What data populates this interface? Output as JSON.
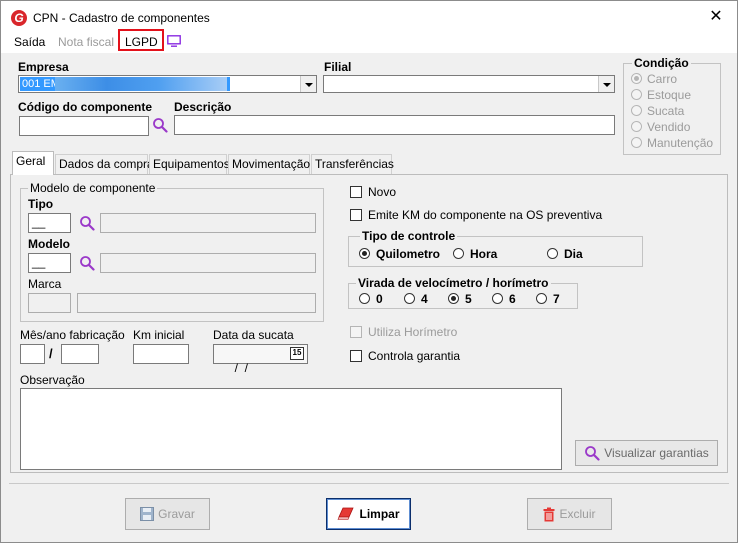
{
  "window": {
    "title": "CPN - Cadastro de componentes"
  },
  "menu": {
    "exit": "Saída",
    "invoice": "Nota fiscal",
    "lgpd": "LGPD"
  },
  "fields": {
    "company_label": "Empresa",
    "company_value": "001 EM",
    "branch_label": "Filial",
    "component_code_label": "Código do componente",
    "description_label": "Descrição"
  },
  "condition": {
    "title": "Condição",
    "options": [
      "Carro",
      "Estoque",
      "Sucata",
      "Vendido",
      "Manutenção"
    ],
    "selected": "Carro"
  },
  "tabs": [
    "Geral",
    "Dados da compra",
    "Equipamentos",
    "Movimentação",
    "Transferências"
  ],
  "model_group": {
    "title": "Modelo de componente",
    "type_label": "Tipo",
    "type_value": "__",
    "model_label": "Modelo",
    "model_value": "__",
    "brand_label": "Marca"
  },
  "dates": {
    "manufacture_label": "Mês/ano fabricação",
    "separator": "/",
    "km_label": "Km inicial",
    "scrap_date_label": "Data da sucata",
    "scrap_date_value": " /  /",
    "calendar_day": "15"
  },
  "observation_label": "Observação",
  "checkboxes": {
    "new": "Novo",
    "emit_km": "Emite KM do componente na OS preventiva",
    "use_hourmeter": "Utiliza Horímetro",
    "warranty_control": "Controla garantia"
  },
  "control_type": {
    "title": "Tipo de controle",
    "options": [
      "Quilometro",
      "Hora",
      "Dia"
    ],
    "selected": "Quilometro"
  },
  "odometer_turn": {
    "title": "Virada de velocímetro / horímetro",
    "options": [
      "0",
      "4",
      "5",
      "6",
      "7"
    ],
    "selected": "5"
  },
  "buttons": {
    "view_warranties": "Visualizar garantias",
    "save": "Gravar",
    "clear": "Limpar",
    "delete": "Excluir"
  }
}
